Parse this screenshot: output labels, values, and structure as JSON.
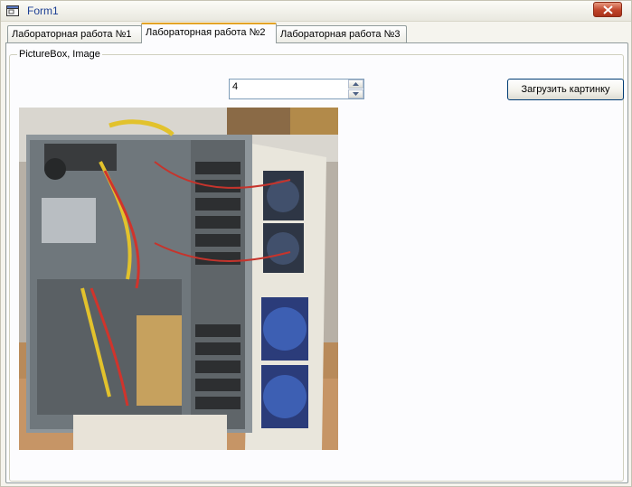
{
  "window": {
    "title": "Form1",
    "close_label": "×"
  },
  "tabs": [
    {
      "label": "Лабораторная работа №1",
      "active": false
    },
    {
      "label": "Лабораторная работа №2",
      "active": true
    },
    {
      "label": "Лабораторная работа №3",
      "active": false
    }
  ],
  "group": {
    "title": "PictureBox, Image"
  },
  "numeric": {
    "value": "4"
  },
  "load_button": {
    "label": "Загрузить картинку"
  },
  "picture": {
    "description_icon": "computer-case-photo"
  }
}
